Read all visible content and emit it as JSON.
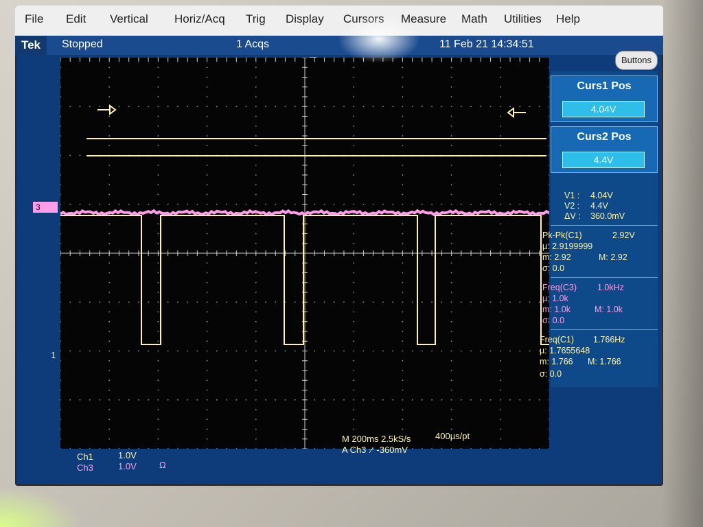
{
  "menu": [
    "File",
    "Edit",
    "Vertical",
    "Horiz/Acq",
    "Trig",
    "Display",
    "Cursors",
    "Measure",
    "Math",
    "Utilities",
    "Help"
  ],
  "status": {
    "brand": "Tek",
    "state": "Stopped",
    "acqs": "1 Acqs",
    "datetime": "11 Feb 21 14:34:51",
    "buttons_label": "Buttons"
  },
  "cursors": {
    "curs1_title": "Curs1 Pos",
    "curs1_value": "4.04V",
    "curs2_title": "Curs2 Pos",
    "curs2_value": "4.4V",
    "v1_label": "V1 :",
    "v1_value": "4.04V",
    "v2_label": "V2 :",
    "v2_value": "4.4V",
    "dv_label": "ΔV :",
    "dv_value": "360.0mV"
  },
  "measurements": {
    "pkpk": {
      "label": "Pk-Pk(C1)",
      "value": "2.92V",
      "mu": "µ: 2.9199999",
      "m": "m: 2.92",
      "M": "M: 2.92",
      "sigma": "σ: 0.0"
    },
    "freq_c3": {
      "label": "Freq(C3)",
      "value": "1.0kHz",
      "mu": "µ: 1.0k",
      "m": "m: 1.0k",
      "M": "M: 1.0k",
      "sigma": "σ: 0.0"
    },
    "freq_c1": {
      "label": "Freq(C1)",
      "value": "1.766Hz",
      "mu": "µ: 1.7655648",
      "m": "m: 1.766",
      "M": "M: 1.766",
      "sigma": "σ: 0.0"
    }
  },
  "bottom": {
    "ch1_label": "Ch1",
    "ch1_scale": "1.0V",
    "ch3_label": "Ch3",
    "ch3_scale": "1.0V",
    "ch3_coupling": "Ω",
    "timebase": "M 200ms 2.5kS/s",
    "record": "400µs/pt",
    "trigger": "A Ch3 ⌿ -360mV"
  },
  "markers": {
    "ch3": "3",
    "ch1": "1"
  },
  "colors": {
    "ch1": "#fff4a6",
    "ch3": "#ff9de6",
    "screen_bg": "#0e3c7a",
    "panel": "#1769b3"
  }
}
